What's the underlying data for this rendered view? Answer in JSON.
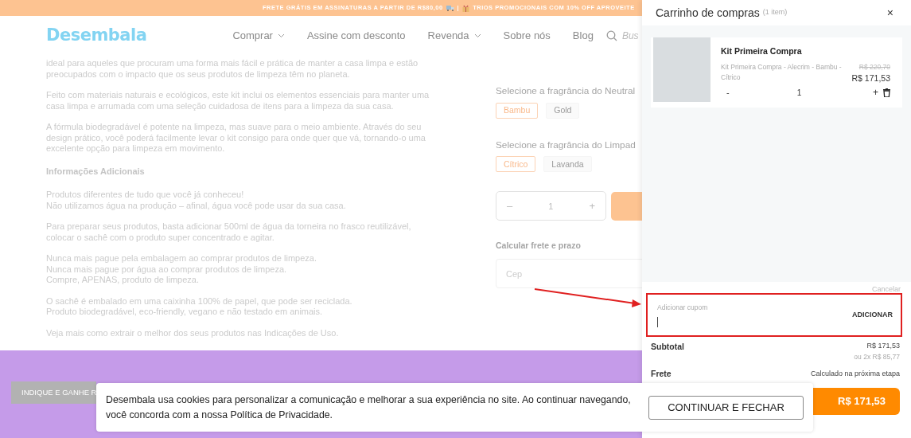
{
  "promo_bar": {
    "segments": [
      {
        "kind": "text",
        "text": "FRETE GRÁTIS EM ASSINATURAS A PARTIR DE R$80,00"
      },
      {
        "kind": "truck"
      },
      {
        "kind": "text",
        "text": "|"
      },
      {
        "kind": "gift"
      },
      {
        "kind": "text",
        "text": "TRIOS PROMOCIONAIS COM 10% OFF APROVEITE"
      }
    ]
  },
  "header": {
    "logo": "Desembala",
    "nav": [
      {
        "label": "Comprar",
        "dropdown": true
      },
      {
        "label": "Assine com desconto",
        "dropdown": false
      },
      {
        "label": "Revenda",
        "dropdown": true
      },
      {
        "label": "Sobre nós",
        "dropdown": false
      },
      {
        "label": "Blog",
        "dropdown": false
      }
    ],
    "search": {
      "placeholder": "Bus"
    }
  },
  "description": {
    "blocks": [
      {
        "kind": "paragraph",
        "text": "ideal para aqueles que procuram uma forma mais fácil e prática de manter a casa limpa e estão preocupados com o impacto que os seus produtos de limpeza têm no planeta."
      },
      {
        "kind": "paragraph",
        "text": "Feito com materiais naturais e ecológicos, este kit inclui os elementos essenciais para manter uma casa limpa e arrumada com uma seleção cuidadosa de itens para a limpeza da sua casa."
      },
      {
        "kind": "paragraph",
        "text": "A fórmula biodegradável é potente na limpeza, mas suave para o meio ambiente. Através do seu design prático, você poderá facilmente levar o kit consigo para onde quer que vá, tornando-o uma excelente opção para limpeza em movimento."
      },
      {
        "kind": "heading",
        "text": "Informações Adicionais"
      },
      {
        "kind": "paragraph",
        "text": "Produtos diferentes de tudo que você já conheceu!\nNão utilizamos água na produção – afinal, água você pode usar da sua casa."
      },
      {
        "kind": "paragraph",
        "text": "Para preparar seus produtos, basta adicionar 500ml de água da torneira no frasco reutilizável, colocar o sachê com o produto super concentrado e agitar."
      },
      {
        "kind": "paragraph",
        "text": "Nunca mais pague pela embalagem ao comprar produtos de limpeza.\nNunca mais pague por água ao comprar produtos de limpeza.\nCompre, APENAS, produto de limpeza."
      },
      {
        "kind": "paragraph",
        "text": "O sachê é embalado em uma caixinha 100% de papel, que pode ser reciclada.\nProduto biodegradável, eco-friendly, vegano e não testado em animais."
      },
      {
        "kind": "paragraph",
        "text": "Veja mais como extrair o melhor dos seus produtos nas Indicações de Uso."
      }
    ]
  },
  "product": {
    "fragrance_groups": [
      {
        "label": "Selecione a fragrância do Neutral",
        "options": [
          {
            "label": "Bambu",
            "selected": true
          },
          {
            "label": "Gold",
            "selected": false
          }
        ]
      },
      {
        "label": "Selecione a fragrância do Limpad",
        "options": [
          {
            "label": "Cítrico",
            "selected": true
          },
          {
            "label": "Lavanda",
            "selected": false
          }
        ]
      }
    ],
    "quantity": {
      "decrement": "–",
      "value": "1",
      "increment": "+"
    },
    "shipping": {
      "label": "Calcular frete e prazo",
      "placeholder": "Cep"
    }
  },
  "referral_button": {
    "label": "INDIQUE E GANHE R"
  },
  "cart": {
    "title": "Carrinho de compras",
    "count": "(1 item)",
    "close": "×",
    "items": [
      {
        "name": "Kit Primeira Compra",
        "variant": "Kit Primeira Compra - Alecrim - Bambu - Cítrico",
        "old_price": "R$ 220,70",
        "price": "R$ 171,53",
        "decrement": "-",
        "quantity": "1",
        "increment": "+"
      }
    ],
    "coupon": {
      "cancel": "Cancelar",
      "placeholder": "Adicionar cupom",
      "button": "ADICIONAR",
      "highlighted": true
    },
    "subtotal": {
      "label": "Subtotal",
      "value": "R$ 171,53",
      "installments": "ou 2x R$ 85,77"
    },
    "shipping": {
      "label": "Frete",
      "value": "Calculado na próxima etapa"
    },
    "checkout": {
      "price": "R$ 171,53"
    }
  },
  "cookie_banner": {
    "text": "Desembala usa cookies para personalizar a comunicação e melhorar a sua experiência no site. Ao continuar navegando, você concorda com a nossa Política de Privacidade.",
    "button": "CONTINUAR E FECHAR"
  }
}
